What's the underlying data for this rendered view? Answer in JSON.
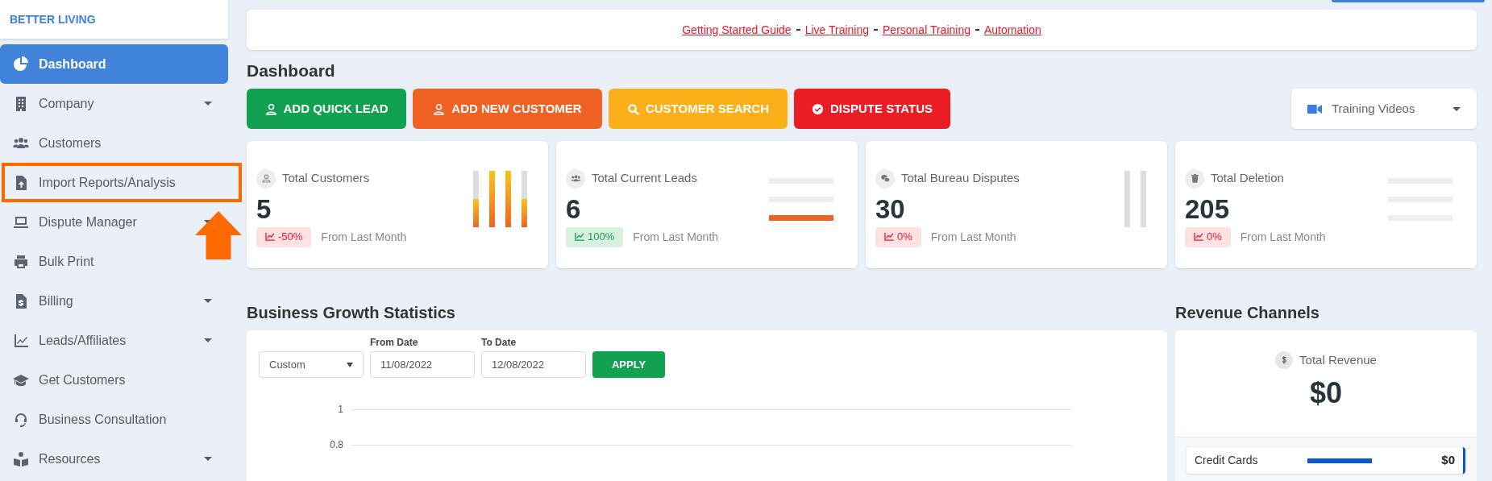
{
  "brand": "BETTER LIVING",
  "sidebar": {
    "items": [
      {
        "label": "Dashboard",
        "selected": true,
        "has_caret": false
      },
      {
        "label": "Company",
        "selected": false,
        "has_caret": true
      },
      {
        "label": "Customers",
        "selected": false,
        "has_caret": false
      },
      {
        "label": "Import Reports/Analysis",
        "selected": false,
        "has_caret": false,
        "highlighted": true
      },
      {
        "label": "Dispute Manager",
        "selected": false,
        "has_caret": true
      },
      {
        "label": "Bulk Print",
        "selected": false,
        "has_caret": false
      },
      {
        "label": "Billing",
        "selected": false,
        "has_caret": true
      },
      {
        "label": "Leads/Affiliates",
        "selected": false,
        "has_caret": true
      },
      {
        "label": "Get Customers",
        "selected": false,
        "has_caret": false
      },
      {
        "label": "Business Consultation",
        "selected": false,
        "has_caret": false
      },
      {
        "label": "Resources",
        "selected": false,
        "has_caret": true
      }
    ]
  },
  "top_links": [
    "Getting Started Guide",
    "Live Training",
    "Personal Training",
    "Automation"
  ],
  "heading": "Dashboard",
  "actions": [
    {
      "label": "ADD QUICK LEAD",
      "color": "#12a150"
    },
    {
      "label": "ADD NEW CUSTOMER",
      "color": "#ef6223"
    },
    {
      "label": "CUSTOMER SEARCH",
      "color": "#fbb01a"
    },
    {
      "label": "DISPUTE STATUS",
      "color": "#ea1c24"
    }
  ],
  "training_dropdown": {
    "label": "Training Videos"
  },
  "stats": [
    {
      "title": "Total Customers",
      "value": "5",
      "change": "-50%",
      "positive": false,
      "note": "From Last Month",
      "kind": "vertical",
      "bars": [
        {
          "level": 0.5
        },
        {
          "level": 1
        },
        {
          "level": 1
        },
        {
          "level": 0.5
        }
      ]
    },
    {
      "title": "Total Current Leads",
      "value": "6",
      "change": "100%",
      "positive": true,
      "note": "From Last Month",
      "kind": "horizontal",
      "bars": [
        {
          "level": 0
        },
        {
          "level": 0
        },
        {
          "level": 1
        }
      ]
    },
    {
      "title": "Total Bureau Disputes",
      "value": "30",
      "change": "0%",
      "positive": false,
      "note": "From Last Month",
      "kind": "vertical",
      "bars": [
        {
          "level": 0
        },
        {
          "level": 0
        }
      ]
    },
    {
      "title": "Total Deletion",
      "value": "205",
      "change": "0%",
      "positive": false,
      "note": "From Last Month",
      "kind": "horizontal",
      "bars": [
        {
          "level": 0
        },
        {
          "level": 0
        },
        {
          "level": 0
        }
      ]
    }
  ],
  "growth": {
    "title": "Business Growth Statistics",
    "range_select": "Custom",
    "from_label": "From Date",
    "from_value": "11/08/2022",
    "to_label": "To Date",
    "to_value": "12/08/2022",
    "apply": "APPLY",
    "axis_ticks": [
      "1",
      "0.8"
    ]
  },
  "revenue": {
    "title": "Revenue Channels",
    "total_label": "Total Revenue",
    "total_value": "$0",
    "channels": [
      {
        "name": "Credit Cards",
        "value": "$0",
        "color": "#0b57d0"
      }
    ]
  }
}
